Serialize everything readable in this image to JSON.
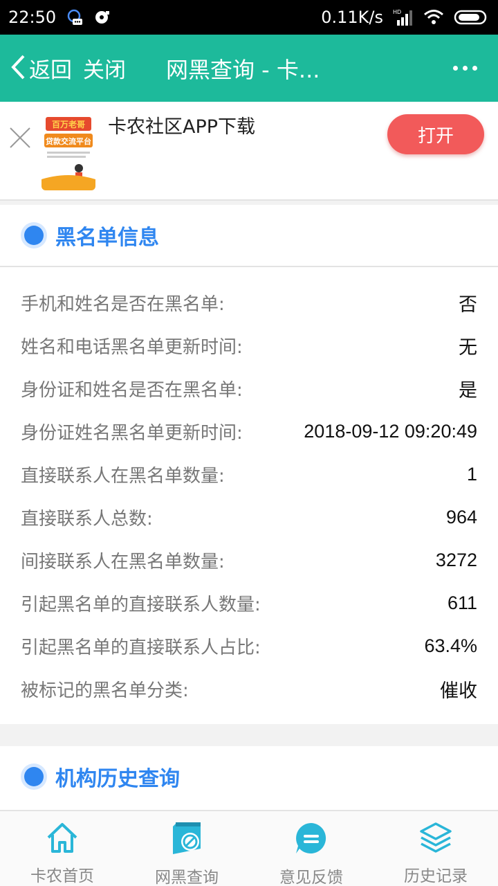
{
  "status_bar": {
    "time": "22:50",
    "net_speed": "0.11K/s",
    "hd": "HD"
  },
  "header": {
    "back_label": "返回",
    "close_label": "关闭",
    "title": "网黑查询 - 卡..."
  },
  "banner": {
    "title": "卡农社区APP下载",
    "open_label": "打开",
    "logo_text": [
      "百万老哥",
      "贷款交流平台"
    ]
  },
  "blacklist": {
    "title": "黑名单信息",
    "rows": [
      {
        "label": "手机和姓名是否在黑名单:",
        "value": "否"
      },
      {
        "label": "姓名和电话黑名单更新时间:",
        "value": "无"
      },
      {
        "label": "身份证和姓名是否在黑名单:",
        "value": "是"
      },
      {
        "label": "身份证姓名黑名单更新时间:",
        "value": "2018-09-12 09:20:49"
      },
      {
        "label": "直接联系人在黑名单数量:",
        "value": "1"
      },
      {
        "label": "直接联系人总数:",
        "value": "964"
      },
      {
        "label": "间接联系人在黑名单数量:",
        "value": "3272"
      },
      {
        "label": "引起黑名单的直接联系人数量:",
        "value": "611"
      },
      {
        "label": "引起黑名单的直接联系人占比:",
        "value": "63.4%"
      },
      {
        "label": "被标记的黑名单分类:",
        "value": "催收"
      }
    ]
  },
  "history": {
    "title": "机构历史查询"
  },
  "bottom_nav": [
    {
      "label": "卡农首页",
      "icon": "home-icon"
    },
    {
      "label": "网黑查询",
      "icon": "blacklist-query-icon"
    },
    {
      "label": "意见反馈",
      "icon": "feedback-icon"
    },
    {
      "label": "历史记录",
      "icon": "layers-icon"
    }
  ],
  "colors": {
    "header_bg": "#1dba9b",
    "accent_blue": "#2f86f0",
    "open_button": "#f25a5a",
    "nav_icon": "#2ab6d8"
  }
}
